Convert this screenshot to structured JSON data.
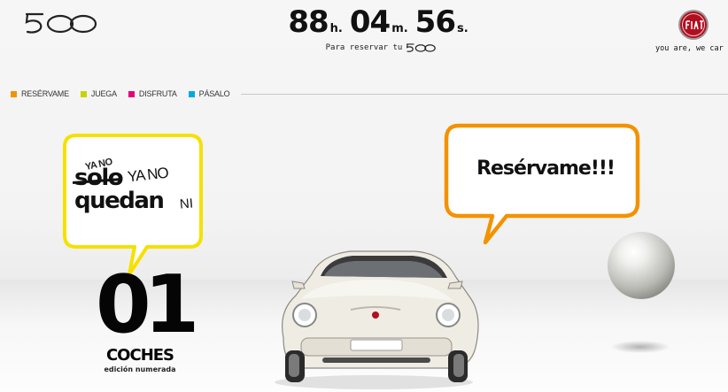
{
  "header": {
    "logo_icon": "fiat-500-wordmark-icon",
    "countdown": {
      "hours": "88",
      "hours_unit": "h.",
      "minutes": "04",
      "minutes_unit": "m.",
      "seconds": "56",
      "seconds_unit": "s.",
      "caption": "Para reservar tu"
    },
    "badge_icon": "fiat-badge-icon",
    "tagline": "you are, we car"
  },
  "nav": {
    "items": [
      {
        "label": "RESÉRVAME",
        "color": "#f39200"
      },
      {
        "label": "JUEGA",
        "color": "#c8d400"
      },
      {
        "label": "DISFRUTA",
        "color": "#e5007e"
      },
      {
        "label": "PÁSALO",
        "color": "#00a9e0"
      }
    ]
  },
  "bubble_left": {
    "border_color": "#f5e100",
    "scribble": "YA NO",
    "word1": "solo",
    "word1_overlay": "YA NO",
    "word2": "quedan",
    "word2_overlay": "NI"
  },
  "counter": {
    "number": "01",
    "label": "COCHES",
    "sublabel": "edición numerada"
  },
  "bubble_right": {
    "border_color": "#f39200",
    "text": "Resérvame!!!"
  },
  "scene": {
    "car_icon": "fiat-500-car-image",
    "sphere_icon": "chrome-sphere-icon"
  }
}
